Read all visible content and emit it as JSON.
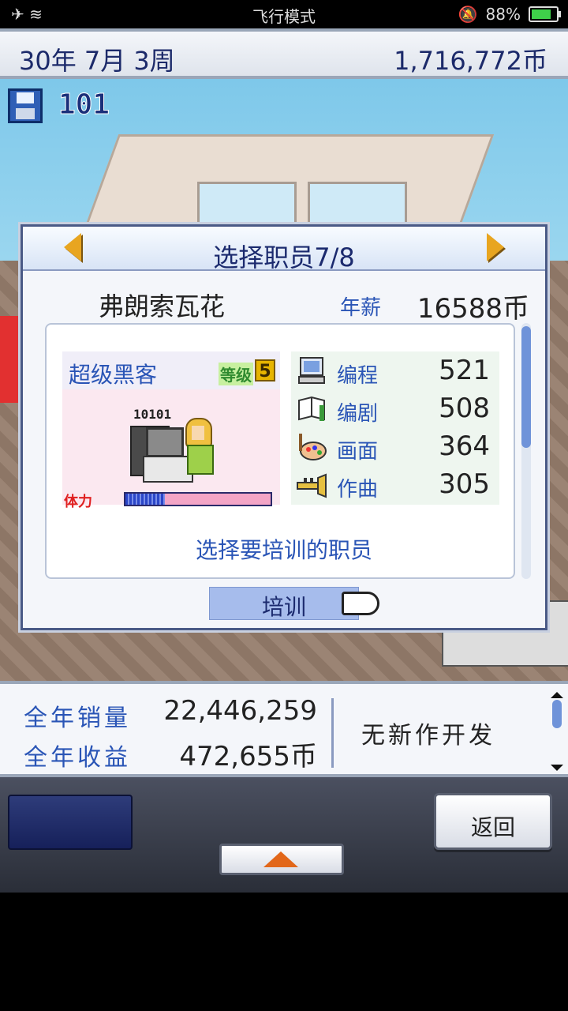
{
  "status_bar": {
    "carrier_icons": "airplane + wifi",
    "mode": "飞行模式",
    "battery_percent": "88%"
  },
  "top": {
    "date": "30年 7月 3周",
    "money": "1,716,772币"
  },
  "save": {
    "count": "101"
  },
  "dialog": {
    "title": "选择职员7/8",
    "employee_name": "弗朗索瓦花",
    "salary_label": "年薪",
    "salary_value": "16588币",
    "job": "超级黑客",
    "level_label": "等级",
    "level_value": "5",
    "code_text": "10101",
    "hp_label": "体力",
    "stamina_fraction": 0.27,
    "stats": [
      {
        "label": "编程",
        "value": "521",
        "icon": "computer-icon"
      },
      {
        "label": "编剧",
        "value": "508",
        "icon": "book-icon"
      },
      {
        "label": "画面",
        "value": "364",
        "icon": "palette-icon"
      },
      {
        "label": "作曲",
        "value": "305",
        "icon": "trumpet-icon"
      }
    ],
    "hint": "选择要培训的职员",
    "train_button": "培训"
  },
  "info": {
    "annual_sales_label": "全年销量",
    "annual_sales_value": "22,446,259",
    "annual_income_label": "全年收益",
    "annual_income_value": "472,655币",
    "status": "无新作开发"
  },
  "controls": {
    "back_label": "返回"
  },
  "colors": {
    "accent_blue": "#2a55b6",
    "dark_text": "#1b2a6e",
    "button_highlight": "#a6bcec",
    "up_arrow": "#e2671a"
  }
}
